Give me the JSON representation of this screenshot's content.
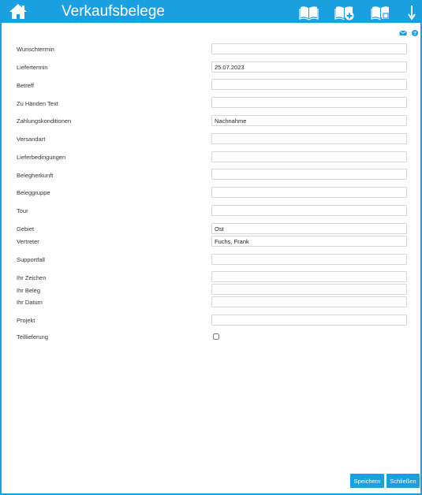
{
  "header": {
    "title": "Verkaufsbelege",
    "icons": [
      "home-icon",
      "book-icon",
      "book-plus-icon",
      "book-copy-icon",
      "arrow-down-icon"
    ]
  },
  "toolbar": {
    "icons": [
      "mail-icon",
      "help-icon"
    ]
  },
  "form": {
    "fields": [
      {
        "label": "Wunschtermin",
        "value": ""
      },
      {
        "label": "Liefertermin",
        "value": "25.07.2023"
      },
      {
        "label": "Betreff",
        "value": ""
      },
      {
        "label": "Zu Händen Text",
        "value": ""
      },
      {
        "label": "Zahlungskonditionen",
        "value": "Nachnahme"
      },
      {
        "label": "Versandart",
        "value": ""
      },
      {
        "label": "Lieferbedingungen",
        "value": ""
      },
      {
        "label": "Belegherkunft",
        "value": ""
      },
      {
        "label": "Beleggruppe",
        "value": ""
      },
      {
        "label": "Tour",
        "value": ""
      },
      {
        "label": "Gebiet",
        "value": "Ost"
      },
      {
        "label": "Vertreter",
        "value": "Fuchs, Frank"
      },
      {
        "label": "Supportfall",
        "value": ""
      },
      {
        "label": "Ihr Zeichen",
        "value": ""
      },
      {
        "label": "Ihr Beleg",
        "value": ""
      },
      {
        "label": "Ihr Datum",
        "value": ""
      },
      {
        "label": "Projekt",
        "value": ""
      }
    ],
    "teillieferung": {
      "label": "Teillieferung",
      "checked": false
    }
  },
  "buttons": {
    "save_label": "Speichern",
    "close_label": "Schließen"
  },
  "colors": {
    "accent": "#1a9fe0",
    "border": "#d6d6d6"
  }
}
